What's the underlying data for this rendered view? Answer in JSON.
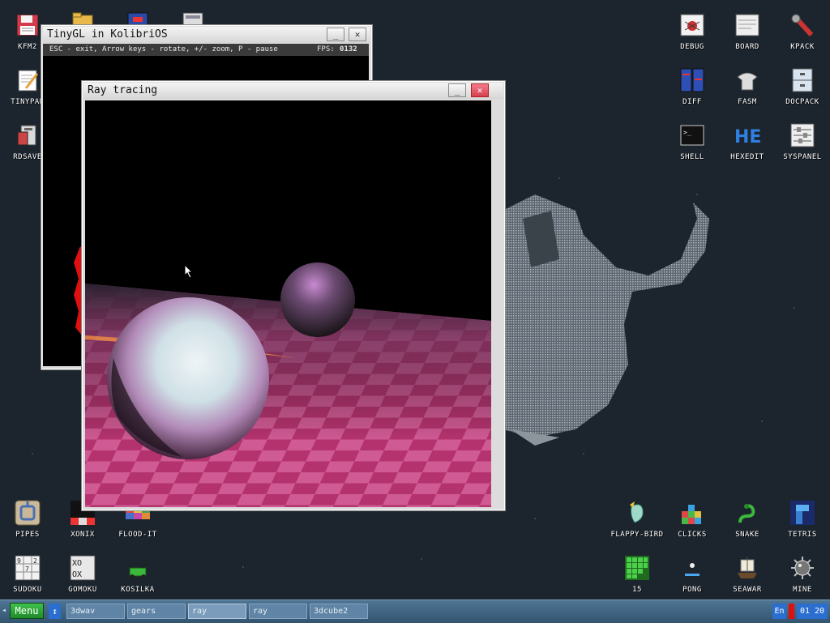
{
  "desktop_icons": {
    "left": [
      {
        "label": "KFM2",
        "icon": "floppy-disk-icon"
      },
      {
        "label": "TINYPAD",
        "icon": "notepad-icon"
      },
      {
        "label": "RDSAVE",
        "icon": "ram-disk-icon"
      },
      {
        "label": "PIPES",
        "icon": "pipes-icon"
      },
      {
        "label": "XONIX",
        "icon": "xonix-icon"
      },
      {
        "label": "FLOOD-IT",
        "icon": "flood-it-icon"
      },
      {
        "label": "SUDOKU",
        "icon": "sudoku-icon"
      },
      {
        "label": "GOMOKU",
        "icon": "gomoku-icon"
      },
      {
        "label": "KOSILKA",
        "icon": "lawnmower-icon"
      }
    ],
    "right": [
      {
        "label": "DEBUG",
        "icon": "debug-bug-icon"
      },
      {
        "label": "BOARD",
        "icon": "board-icon"
      },
      {
        "label": "KPACK",
        "icon": "wrench-icon"
      },
      {
        "label": "DIFF",
        "icon": "diff-icon"
      },
      {
        "label": "FASM",
        "icon": "fasm-icon"
      },
      {
        "label": "DOCPACK",
        "icon": "cabinet-icon"
      },
      {
        "label": "SHELL",
        "icon": "terminal-icon"
      },
      {
        "label": "HEXEDIT",
        "icon": "hex-icon"
      },
      {
        "label": "SYSPANEL",
        "icon": "sliders-icon"
      },
      {
        "label": "FLAPPY-BIRD",
        "icon": "bird-icon"
      },
      {
        "label": "CLICKS",
        "icon": "blocks-icon"
      },
      {
        "label": "SNAKE",
        "icon": "snake-icon"
      },
      {
        "label": "TETRIS",
        "icon": "tetris-icon"
      },
      {
        "label": "15",
        "icon": "puzzle-15-icon"
      },
      {
        "label": "PONG",
        "icon": "pong-icon"
      },
      {
        "label": "SEAWAR",
        "icon": "ship-icon"
      },
      {
        "label": "MINE",
        "icon": "mine-icon"
      }
    ]
  },
  "tinygl_window": {
    "title": "TinyGL in KolibriOS",
    "info": "ESC - exit, Arrow keys - rotate, +/- zoom, P - pause",
    "fps_label": "FPS:",
    "fps_value": "0132",
    "minimize": "_",
    "close": "✕"
  },
  "ray_window": {
    "title": "Ray tracing",
    "minimize": "_",
    "close": "✕"
  },
  "taskbar": {
    "menu_label": "Menu",
    "switch_glyph": "↕",
    "tasks": [
      "3dwav",
      "gears",
      "ray",
      "ray",
      "3dcube2"
    ],
    "lang": "En",
    "clock": "01 20"
  }
}
